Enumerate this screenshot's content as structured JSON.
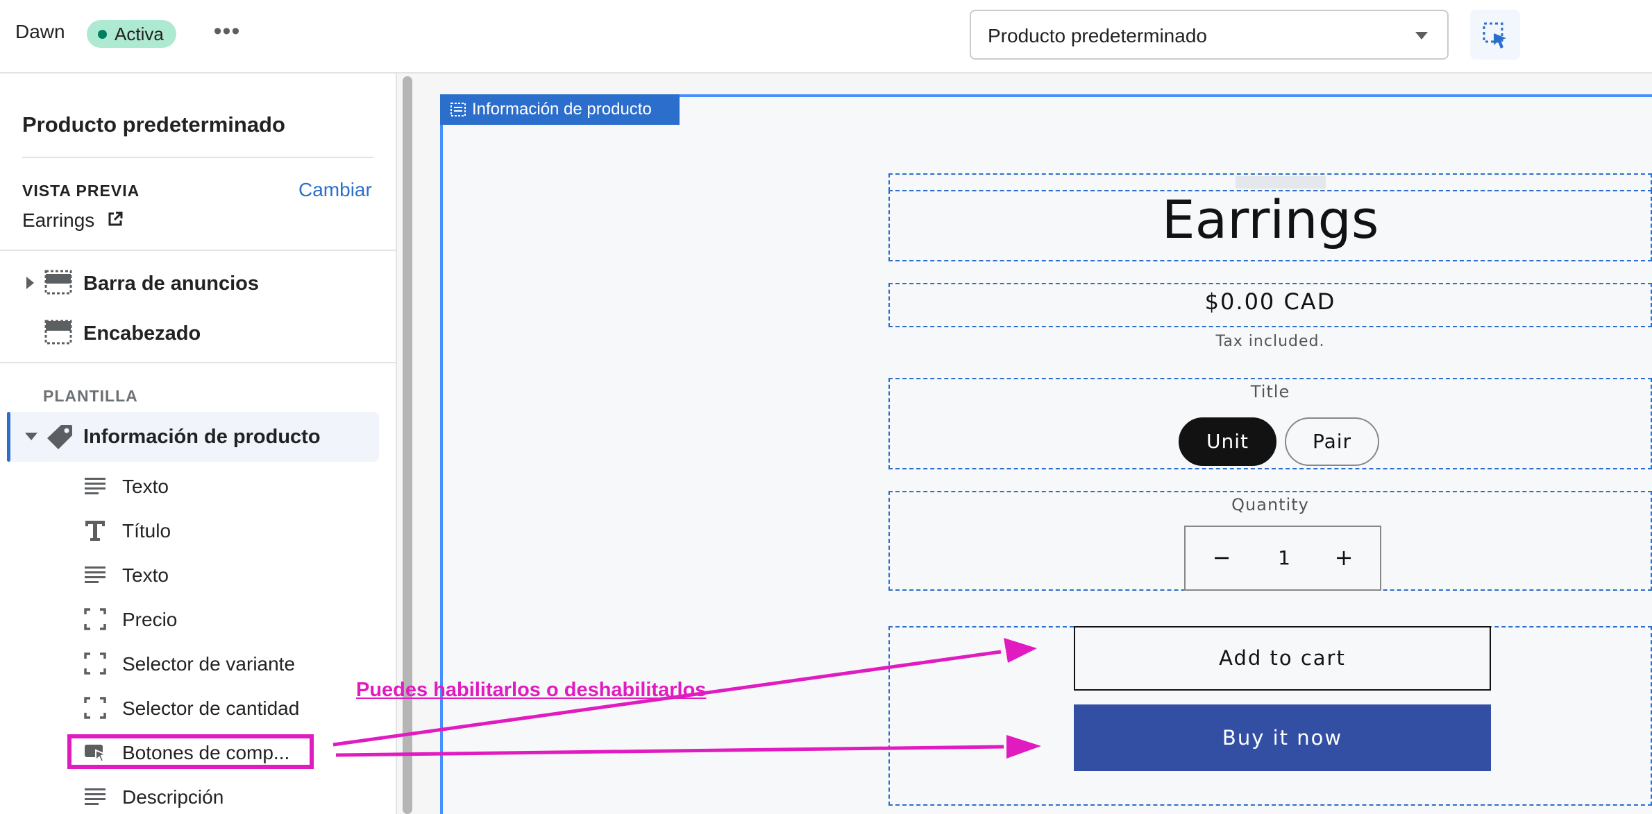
{
  "topbar": {
    "theme_name": "Dawn",
    "status_badge": "Activa",
    "more_label": "•••",
    "template_select_value": "Producto predeterminado"
  },
  "sidebar": {
    "title": "Producto predeterminado",
    "preview_label": "VISTA PREVIA",
    "change_link": "Cambiar",
    "preview_value": "Earrings",
    "header_groups": [
      {
        "label": "Barra de anuncios"
      },
      {
        "label": "Encabezado"
      }
    ],
    "template_label": "PLANTILLA",
    "selected_section": "Información de producto",
    "blocks": [
      {
        "label": "Texto",
        "icon": "text-lines-icon"
      },
      {
        "label": "Título",
        "icon": "title-t-icon"
      },
      {
        "label": "Texto",
        "icon": "text-lines-icon"
      },
      {
        "label": "Precio",
        "icon": "dashed-square-icon"
      },
      {
        "label": "Selector de variante",
        "icon": "dashed-square-icon"
      },
      {
        "label": "Selector de cantidad",
        "icon": "dashed-square-icon"
      },
      {
        "label": "Botones de comp...",
        "icon": "buy-buttons-icon"
      },
      {
        "label": "Descripción",
        "icon": "text-lines-icon"
      }
    ]
  },
  "preview": {
    "section_tab": "Información de producto",
    "product_title": "Earrings",
    "price": "$0.00 CAD",
    "tax_note": "Tax included.",
    "variant_label": "Title",
    "variants": [
      "Unit",
      "Pair"
    ],
    "selected_variant": "Unit",
    "quantity_label": "Quantity",
    "quantity_minus": "−",
    "quantity_value": "1",
    "quantity_plus": "+",
    "add_to_cart": "Add to cart",
    "buy_now": "Buy it now"
  },
  "annotation": {
    "text": "Puedes habilitarlos o deshabilitarlos",
    "color": "#e01cc0"
  },
  "colors": {
    "accent": "#2c6ecb",
    "badge_bg": "#aee9d1",
    "buy_now_bg": "#334fa4"
  }
}
